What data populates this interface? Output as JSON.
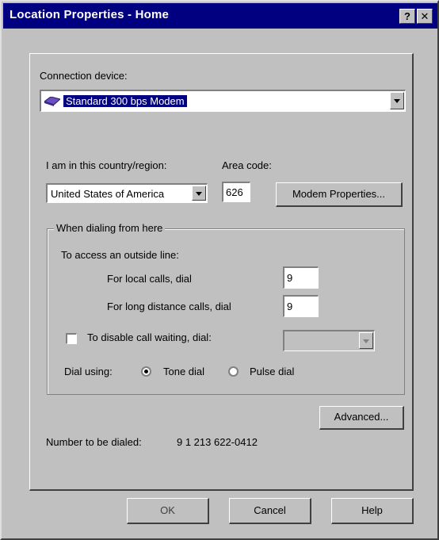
{
  "window": {
    "title": "Location Properties - Home",
    "help_label": "?",
    "close_label": "✕"
  },
  "connection": {
    "label": "Connection device:",
    "value": "Standard  300 bps Modem",
    "icon": "modem-icon"
  },
  "country": {
    "label": "I am in this country/region:",
    "value": "United States of America"
  },
  "area_code": {
    "label": "Area code:",
    "value": "626"
  },
  "modem_properties_button": "Modem Properties...",
  "dialing": {
    "group_label": "When dialing from here",
    "outside_line_label": "To access an outside line:",
    "local_label": "For local calls, dial",
    "local_value": "9",
    "long_distance_label": "For long distance calls, dial",
    "long_distance_value": "9",
    "call_waiting_label": "To disable call waiting, dial:",
    "call_waiting_checked": false,
    "call_waiting_value": "",
    "dial_using_label": "Dial using:",
    "tone_label": "Tone dial",
    "pulse_label": "Pulse dial",
    "selected": "tone"
  },
  "advanced_button": "Advanced...",
  "number_to_dial": {
    "label": "Number to be dialed:",
    "value": "9  1 213 622-0412"
  },
  "footer": {
    "ok": "OK",
    "cancel": "Cancel",
    "help": "Help"
  }
}
